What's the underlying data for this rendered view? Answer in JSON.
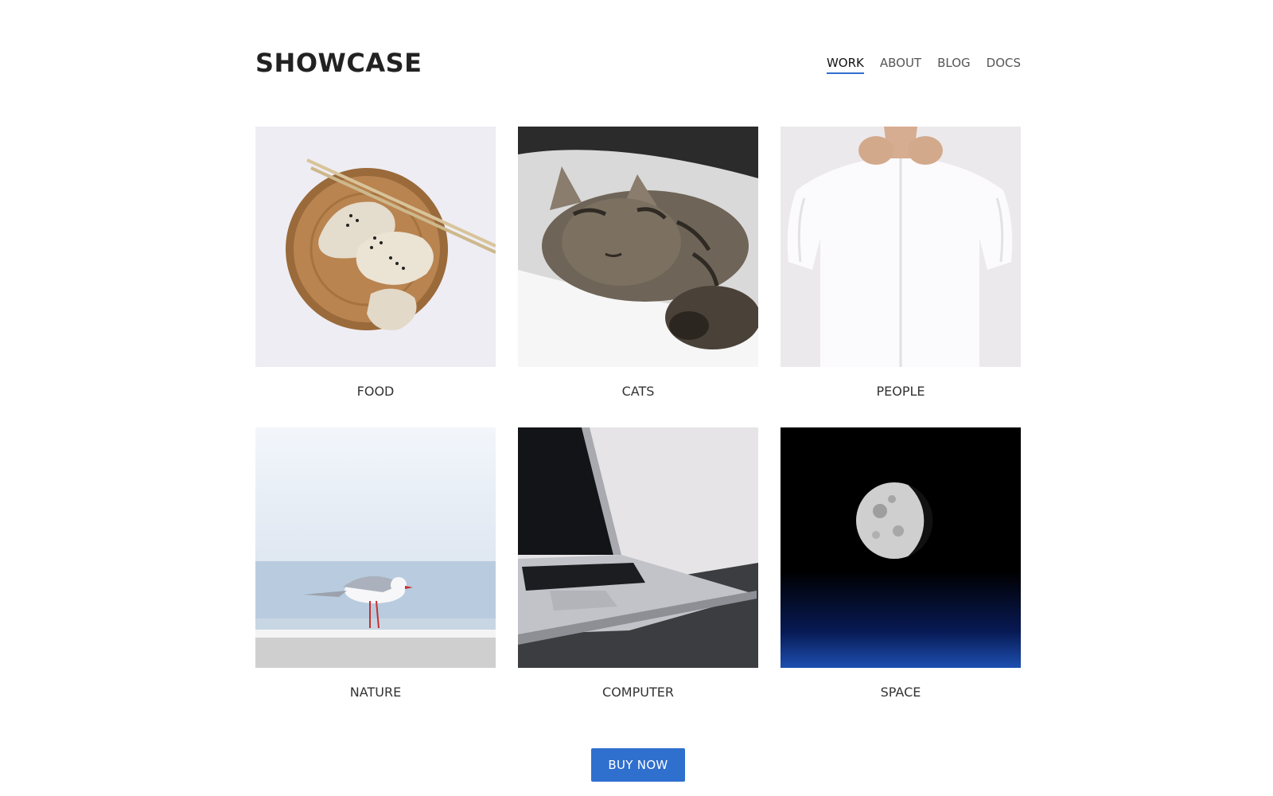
{
  "header": {
    "brand": "SHOWCASE",
    "nav": [
      {
        "label": "WORK",
        "active": true
      },
      {
        "label": "ABOUT",
        "active": false
      },
      {
        "label": "BLOG",
        "active": false
      },
      {
        "label": "DOCS",
        "active": false
      }
    ]
  },
  "gallery": {
    "items": [
      {
        "label": "FOOD",
        "image": "dumplings-on-wooden-plate"
      },
      {
        "label": "CATS",
        "image": "sleeping-tabby-cat"
      },
      {
        "label": "PEOPLE",
        "image": "man-buttoning-white-shirt"
      },
      {
        "label": "NATURE",
        "image": "seagull-by-the-sea"
      },
      {
        "label": "COMPUTER",
        "image": "laptop-closeup"
      },
      {
        "label": "SPACE",
        "image": "moon-in-night-sky"
      }
    ]
  },
  "cta": {
    "label": "BUY NOW"
  },
  "colors": {
    "accent": "#2f6fce",
    "text": "#333333",
    "brand": "#222222"
  }
}
